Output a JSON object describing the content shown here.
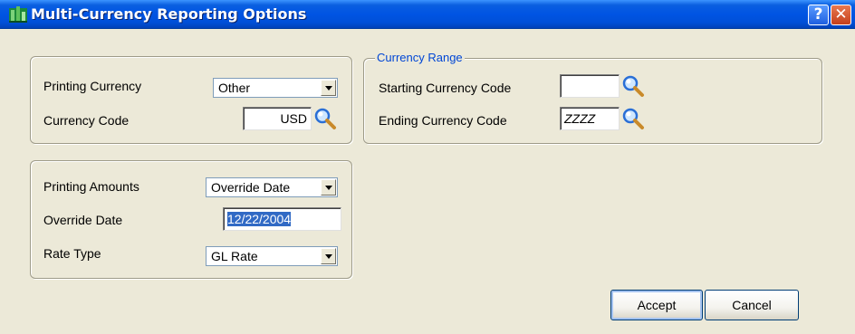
{
  "window": {
    "title": "Multi-Currency Reporting Options",
    "help_button": "?",
    "close_button": "✕"
  },
  "printing_group": {
    "printing_currency_label": "Printing Currency",
    "printing_currency_value": "Other",
    "currency_code_label": "Currency Code",
    "currency_code_value": "USD"
  },
  "currency_range": {
    "legend": "Currency Range",
    "starting_label": "Starting Currency Code",
    "starting_value": "",
    "ending_label": "Ending Currency Code",
    "ending_value": "ZZZZ"
  },
  "amounts_group": {
    "printing_amounts_label": "Printing Amounts",
    "printing_amounts_value": "Override Date",
    "override_date_label": "Override Date",
    "override_date_value": "12/22/2004",
    "rate_type_label": "Rate Type",
    "rate_type_value": "GL Rate"
  },
  "buttons": {
    "accept": "Accept",
    "cancel": "Cancel"
  },
  "colors": {
    "titlebar": "#0054e3",
    "legend_text": "#0046d5",
    "selection": "#316ac5"
  }
}
